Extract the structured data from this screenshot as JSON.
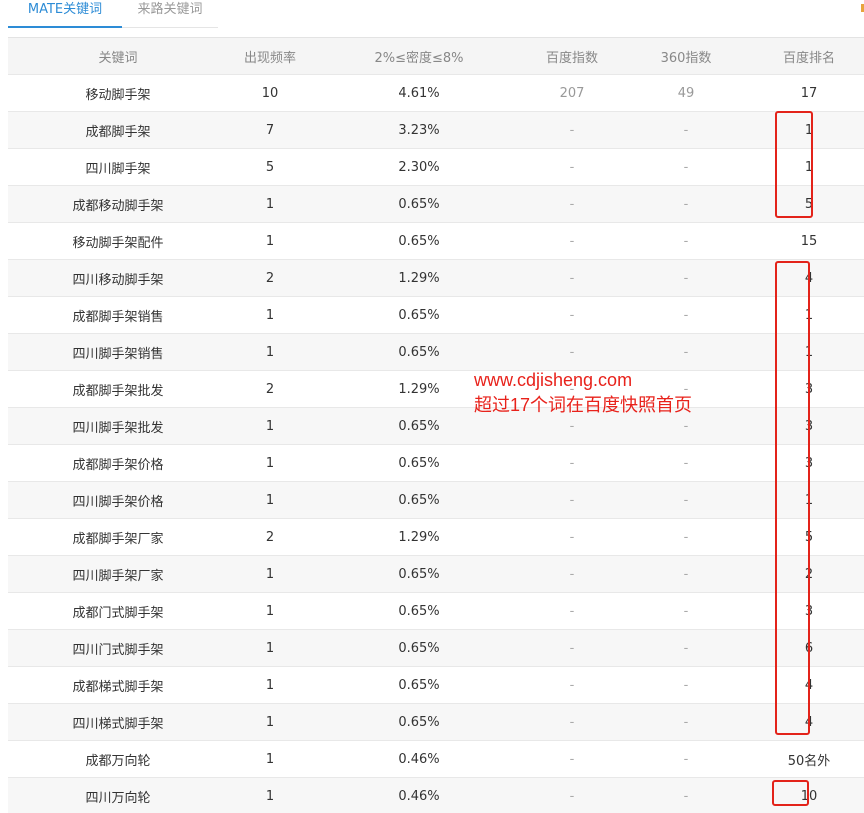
{
  "tabs": [
    {
      "label": "MATE关键词",
      "active": true
    },
    {
      "label": "来路关键词",
      "active": false
    }
  ],
  "table": {
    "headers": [
      "关键词",
      "出现频率",
      "2%≤密度≤8%",
      "百度指数",
      "360指数",
      "百度排名"
    ],
    "rows": [
      {
        "keyword": "移动脚手架",
        "freq": "10",
        "density": "4.61%",
        "baidu_index": "207",
        "index_360": "49",
        "rank": "17"
      },
      {
        "keyword": "成都脚手架",
        "freq": "7",
        "density": "3.23%",
        "baidu_index": "-",
        "index_360": "-",
        "rank": "1"
      },
      {
        "keyword": "四川脚手架",
        "freq": "5",
        "density": "2.30%",
        "baidu_index": "-",
        "index_360": "-",
        "rank": "1"
      },
      {
        "keyword": "成都移动脚手架",
        "freq": "1",
        "density": "0.65%",
        "baidu_index": "-",
        "index_360": "-",
        "rank": "5"
      },
      {
        "keyword": "移动脚手架配件",
        "freq": "1",
        "density": "0.65%",
        "baidu_index": "-",
        "index_360": "-",
        "rank": "15"
      },
      {
        "keyword": "四川移动脚手架",
        "freq": "2",
        "density": "1.29%",
        "baidu_index": "-",
        "index_360": "-",
        "rank": "4"
      },
      {
        "keyword": "成都脚手架销售",
        "freq": "1",
        "density": "0.65%",
        "baidu_index": "-",
        "index_360": "-",
        "rank": "1"
      },
      {
        "keyword": "四川脚手架销售",
        "freq": "1",
        "density": "0.65%",
        "baidu_index": "-",
        "index_360": "-",
        "rank": "1"
      },
      {
        "keyword": "成都脚手架批发",
        "freq": "2",
        "density": "1.29%",
        "baidu_index": "-",
        "index_360": "-",
        "rank": "3"
      },
      {
        "keyword": "四川脚手架批发",
        "freq": "1",
        "density": "0.65%",
        "baidu_index": "-",
        "index_360": "-",
        "rank": "3"
      },
      {
        "keyword": "成都脚手架价格",
        "freq": "1",
        "density": "0.65%",
        "baidu_index": "-",
        "index_360": "-",
        "rank": "3"
      },
      {
        "keyword": "四川脚手架价格",
        "freq": "1",
        "density": "0.65%",
        "baidu_index": "-",
        "index_360": "-",
        "rank": "1"
      },
      {
        "keyword": "成都脚手架厂家",
        "freq": "2",
        "density": "1.29%",
        "baidu_index": "-",
        "index_360": "-",
        "rank": "5"
      },
      {
        "keyword": "四川脚手架厂家",
        "freq": "1",
        "density": "0.65%",
        "baidu_index": "-",
        "index_360": "-",
        "rank": "2"
      },
      {
        "keyword": "成都门式脚手架",
        "freq": "1",
        "density": "0.65%",
        "baidu_index": "-",
        "index_360": "-",
        "rank": "3"
      },
      {
        "keyword": "四川门式脚手架",
        "freq": "1",
        "density": "0.65%",
        "baidu_index": "-",
        "index_360": "-",
        "rank": "6"
      },
      {
        "keyword": "成都梯式脚手架",
        "freq": "1",
        "density": "0.65%",
        "baidu_index": "-",
        "index_360": "-",
        "rank": "4"
      },
      {
        "keyword": "四川梯式脚手架",
        "freq": "1",
        "density": "0.65%",
        "baidu_index": "-",
        "index_360": "-",
        "rank": "4"
      },
      {
        "keyword": "成都万向轮",
        "freq": "1",
        "density": "0.46%",
        "baidu_index": "-",
        "index_360": "-",
        "rank": "50名外"
      },
      {
        "keyword": "四川万向轮",
        "freq": "1",
        "density": "0.46%",
        "baidu_index": "-",
        "index_360": "-",
        "rank": "10"
      }
    ]
  },
  "annotation": {
    "line1": "www.cdjisheng.com",
    "line2": "超过17个词在百度快照首页",
    "color": "#e8221b"
  },
  "colors": {
    "accent": "#2d8cd6",
    "highlight_box": "#e3231a"
  }
}
